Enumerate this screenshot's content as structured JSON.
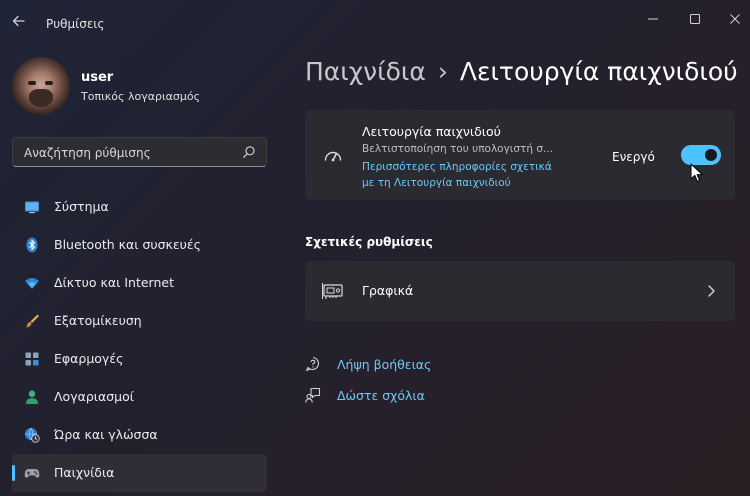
{
  "window": {
    "title": "Ρυθμίσεις"
  },
  "user": {
    "name": "user",
    "account_type": "Τοπικός λογαριασμός"
  },
  "search": {
    "placeholder": "Αναζήτηση ρύθμισης"
  },
  "sidebar": {
    "items": [
      {
        "label": "Σύστημα",
        "icon": "display-icon"
      },
      {
        "label": "Bluetooth και συσκευές",
        "icon": "bluetooth-icon"
      },
      {
        "label": "Δίκτυο και Internet",
        "icon": "wifi-icon"
      },
      {
        "label": "Εξατομίκευση",
        "icon": "brush-icon"
      },
      {
        "label": "Εφαρμογές",
        "icon": "apps-icon"
      },
      {
        "label": "Λογαριασμοί",
        "icon": "person-icon"
      },
      {
        "label": "Ώρα και γλώσσα",
        "icon": "globe-clock-icon"
      },
      {
        "label": "Παιχνίδια",
        "icon": "gamepad-icon"
      }
    ],
    "active_index": 7
  },
  "breadcrumb": {
    "parent": "Παιχνίδια",
    "separator": "›",
    "current": "Λειτουργία παιχνιδιού"
  },
  "game_mode": {
    "title": "Λειτουργία παιχνιδιού",
    "description": "Βελτιστοποίηση του υπολογιστή σ...",
    "link_line1": "Περισσότερες πληροφορίες σχετικά",
    "link_line2": "με τη Λειτουργία παιχνιδιού",
    "state_label": "Ενεργό",
    "enabled": true
  },
  "related": {
    "title": "Σχετικές ρυθμίσεις",
    "graphics_label": "Γραφικά"
  },
  "help": {
    "get_help": "Λήψη βοήθειας",
    "feedback": "Δώστε σχόλια"
  },
  "colors": {
    "accent": "#4cc2ff",
    "link": "#6ec8f5"
  }
}
